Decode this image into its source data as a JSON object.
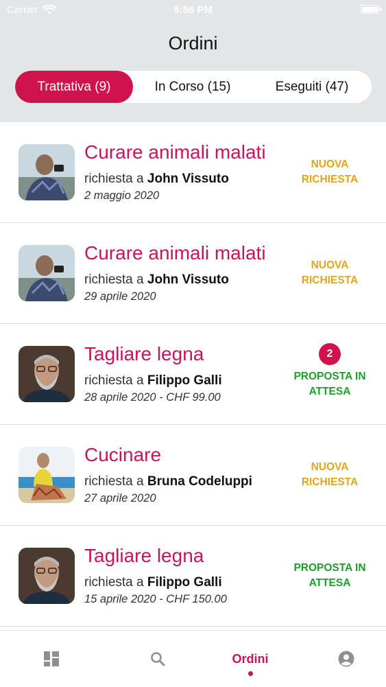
{
  "status_bar": {
    "carrier": "Carrier",
    "time": "5:56 PM"
  },
  "header": {
    "title": "Ordini"
  },
  "tabs": [
    {
      "label": "Trattativa (9)",
      "active": true
    },
    {
      "label": "In Corso (15)",
      "active": false
    },
    {
      "label": "Eseguiti (47)",
      "active": false
    }
  ],
  "orders": [
    {
      "title": "Curare animali malati",
      "prefix": "richiesta a",
      "person": "John Vissuto",
      "date": "2 maggio 2020",
      "status_line1": "NUOVA",
      "status_line2": "RICHIESTA",
      "status_color": "#e2a61a"
    },
    {
      "title": "Curare animali malati",
      "prefix": "richiesta a",
      "person": "John Vissuto",
      "date": "29 aprile 2020",
      "status_line1": "NUOVA",
      "status_line2": "RICHIESTA",
      "status_color": "#e2a61a"
    },
    {
      "title": "Tagliare legna",
      "prefix": "richiesta a",
      "person": "Filippo Galli",
      "date": "28 aprile 2020 - CHF 99.00",
      "badge": "2",
      "status_line1": "PROPOSTA IN",
      "status_line2": "ATTESA",
      "status_color": "#1f9d2a"
    },
    {
      "title": "Cucinare",
      "prefix": "richiesta a",
      "person": "Bruna Codeluppi",
      "date": "27 aprile 2020",
      "status_line1": "NUOVA",
      "status_line2": "RICHIESTA",
      "status_color": "#e2a61a"
    },
    {
      "title": "Tagliare legna",
      "prefix": "richiesta a",
      "person": "Filippo Galli",
      "date": "15 aprile 2020 - CHF 150.00",
      "status_line1": "PROPOSTA IN",
      "status_line2": "ATTESA",
      "status_color": "#1f9d2a"
    }
  ],
  "tab_bar": {
    "items": [
      {
        "icon": "dashboard-icon"
      },
      {
        "icon": "search-icon"
      },
      {
        "label": "Ordini",
        "active": true
      },
      {
        "icon": "profile-icon"
      }
    ]
  },
  "colors": {
    "accent": "#d0134f",
    "title": "#c8145a",
    "new": "#e2a61a",
    "pending": "#1f9d2a",
    "header_bg": "#e4e5e6"
  }
}
